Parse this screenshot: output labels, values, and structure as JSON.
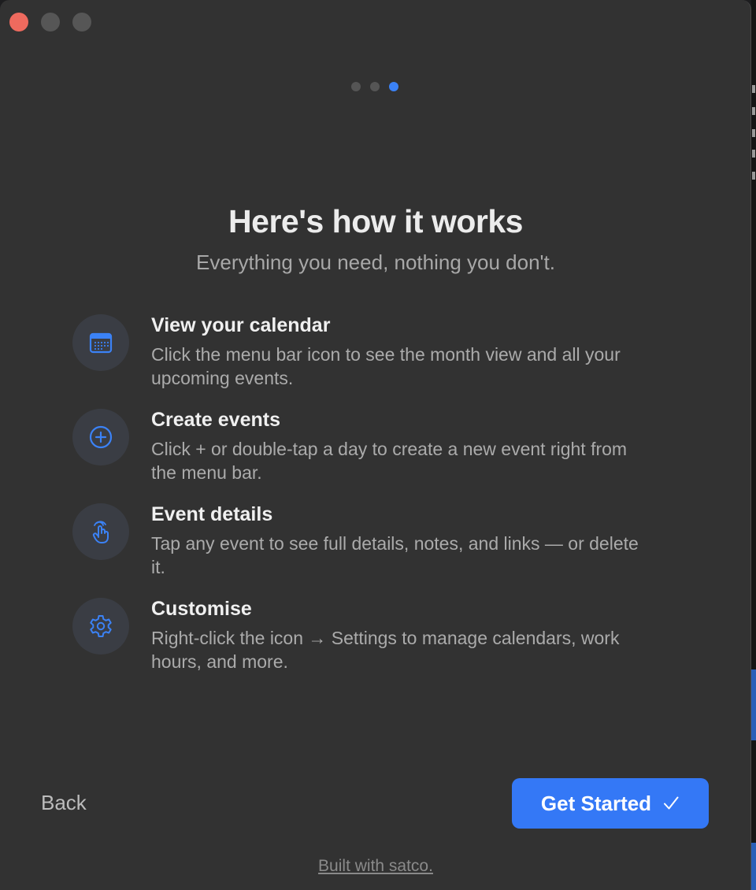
{
  "onboarding": {
    "title": "Here's how it works",
    "subtitle": "Everything you need, nothing you don't.",
    "page_dots": {
      "count": 3,
      "active_index": 2
    },
    "accent_color": "#3b82f6",
    "features": [
      {
        "icon": "calendar-icon",
        "title": "View your calendar",
        "description": "Click the menu bar icon to see the month view and all your upcoming events."
      },
      {
        "icon": "plus-circle-icon",
        "title": "Create events",
        "description": "Click + or double-tap a day to create a new event right from the menu bar."
      },
      {
        "icon": "tap-hand-icon",
        "title": "Event details",
        "description": "Tap any event to see full details, notes, and links — or delete it."
      },
      {
        "icon": "gear-icon",
        "title": "Customise",
        "description": "Right-click the icon → Settings to manage calendars, work hours, and more."
      }
    ],
    "back_label": "Back",
    "primary_label": "Get Started",
    "primary_icon": "checkmark-icon",
    "footer_link": "Built with satco."
  }
}
